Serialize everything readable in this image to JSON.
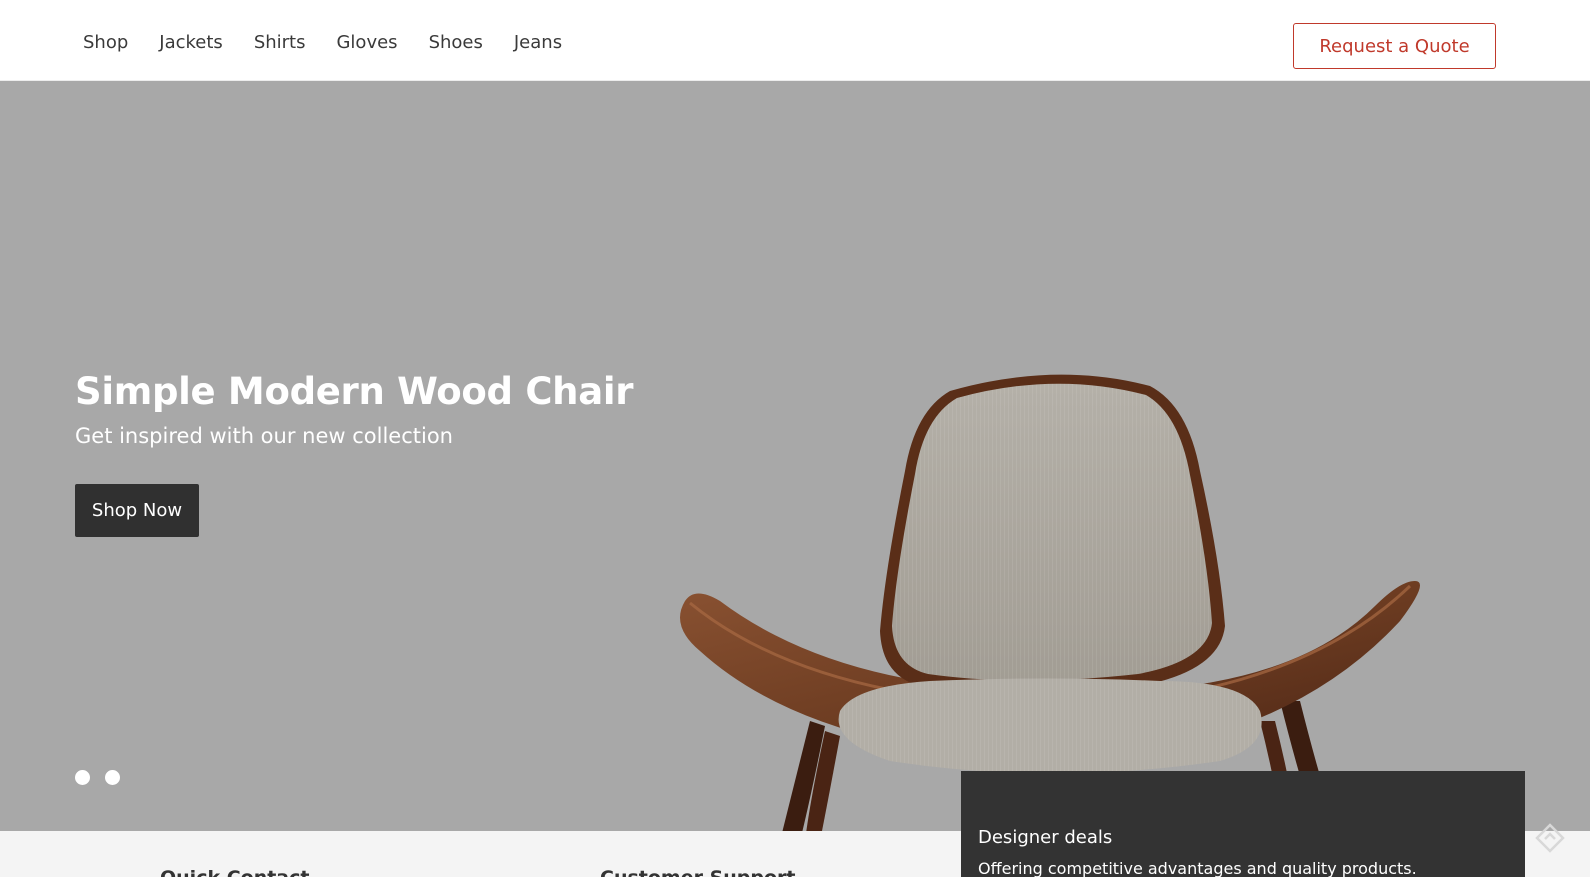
{
  "nav": {
    "items": [
      {
        "label": "Shop"
      },
      {
        "label": "Jackets"
      },
      {
        "label": "Shirts"
      },
      {
        "label": "Gloves"
      },
      {
        "label": "Shoes"
      },
      {
        "label": "Jeans"
      }
    ],
    "quote_label": "Request a Quote"
  },
  "hero": {
    "title": "Simple Modern Wood Chair",
    "subtitle": "Get inspired with our new collection",
    "cta_label": "Shop Now",
    "slide_count": 2,
    "background_color": "#a8a8a8"
  },
  "footer": {
    "headings": [
      "Quick Contact",
      "Customer Support"
    ]
  },
  "promo": {
    "title": "Designer deals",
    "text": "Offering competitive advantages and quality products."
  },
  "colors": {
    "accent": "#c0392b",
    "dark": "#303030",
    "footer_bg": "#f4f4f4"
  },
  "icons": {
    "corner": "diamond-arrow-icon"
  }
}
